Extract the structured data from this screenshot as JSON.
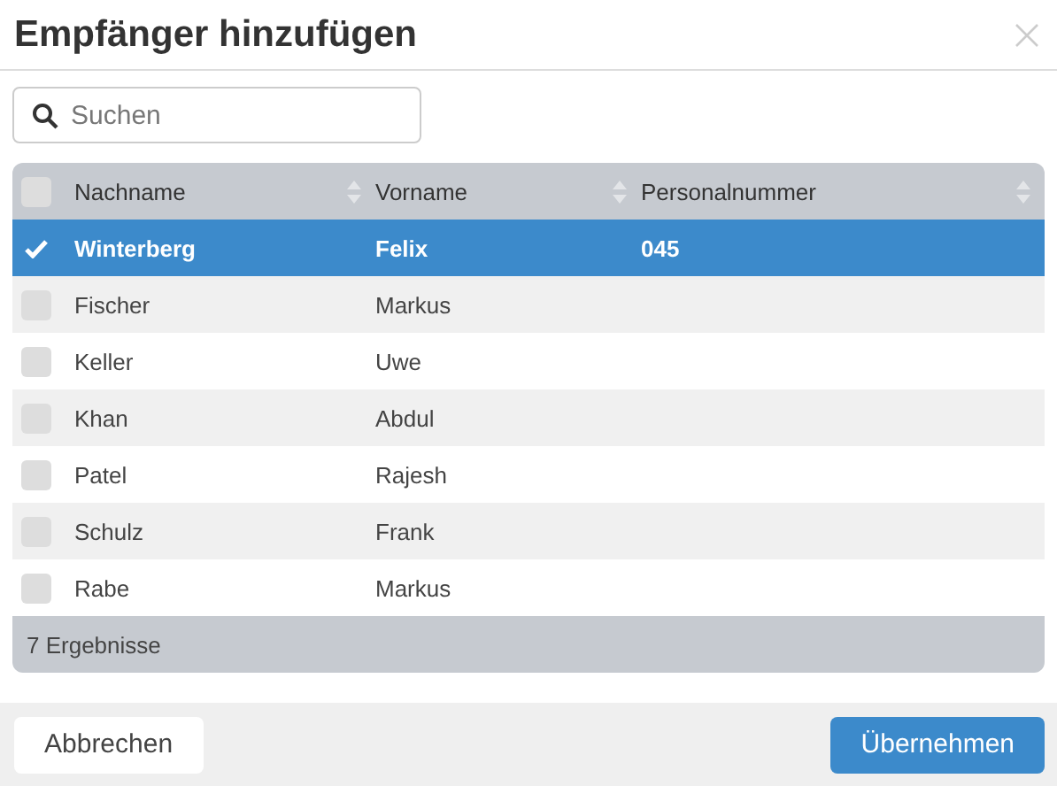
{
  "dialog": {
    "title": "Empfänger hinzufügen"
  },
  "search": {
    "placeholder": "Suchen"
  },
  "table": {
    "select_all": {
      "checked": false
    },
    "columns": [
      "Nachname",
      "Vorname",
      "Personalnummer"
    ],
    "rows": [
      {
        "cells": [
          "Winterberg",
          "Felix",
          "045"
        ],
        "selected": true
      },
      {
        "cells": [
          "Fischer",
          "Markus",
          ""
        ],
        "selected": false
      },
      {
        "cells": [
          "Keller",
          "Uwe",
          ""
        ],
        "selected": false
      },
      {
        "cells": [
          "Khan",
          "Abdul",
          ""
        ],
        "selected": false
      },
      {
        "cells": [
          "Patel",
          "Rajesh",
          ""
        ],
        "selected": false
      },
      {
        "cells": [
          "Schulz",
          "Frank",
          ""
        ],
        "selected": false
      },
      {
        "cells": [
          "Rabe",
          "Markus",
          ""
        ],
        "selected": false
      }
    ],
    "footer": "7 Ergebnisse"
  },
  "buttons": [
    {
      "label": "Abbrechen",
      "kind": "secondary"
    },
    {
      "label": "Übernehmen",
      "kind": "primary"
    }
  ]
}
